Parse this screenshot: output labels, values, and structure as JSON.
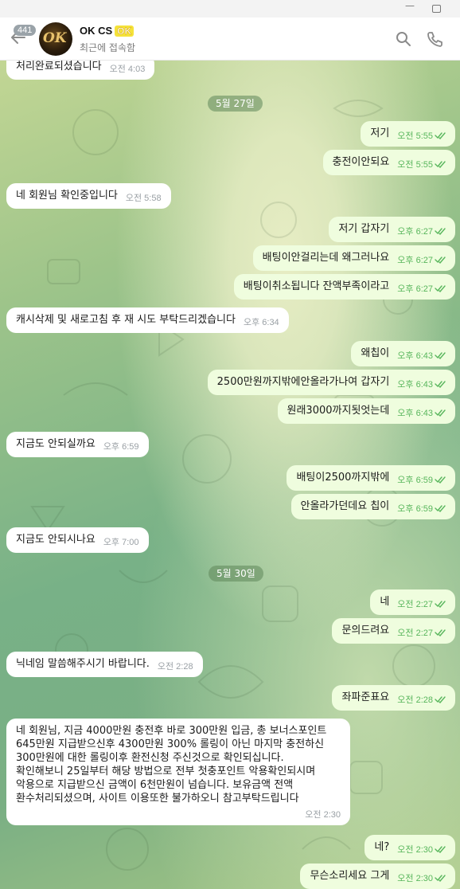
{
  "header": {
    "unread_count": "441",
    "avatar_text": "OK",
    "title": "OK CS",
    "title_badge": "OK",
    "status": "최근에 접속함"
  },
  "chat": {
    "dates": [
      "5월 27일",
      "5월 30일"
    ],
    "messages": [
      {
        "dir": "in",
        "text": "처리완료되셨습니다",
        "time": "오전 4:03"
      },
      {
        "dir": "out",
        "text": "저기",
        "time": "오전 5:55"
      },
      {
        "dir": "out",
        "text": "충전이안되요",
        "time": "오전 5:55"
      },
      {
        "dir": "in",
        "text": "네 회원님 확인중입니다",
        "time": "오전 5:58"
      },
      {
        "dir": "out",
        "text": "저기 갑자기",
        "time": "오후 6:27"
      },
      {
        "dir": "out",
        "text": "배팅이안걸리는데 왜그러나요",
        "time": "오후 6:27"
      },
      {
        "dir": "out",
        "text": "배팅이취소됩니다 잔액부족이라고",
        "time": "오후 6:27"
      },
      {
        "dir": "in",
        "text": "캐시삭제 및 새로고침 후 재 시도 부탁드리겠습니다",
        "time": "오후 6:34"
      },
      {
        "dir": "out",
        "text": "왜칩이",
        "time": "오후 6:43"
      },
      {
        "dir": "out",
        "text": "2500만원까지밖에안올라가나여 갑자기",
        "time": "오후 6:43"
      },
      {
        "dir": "out",
        "text": "원래3000까지됫엇는데",
        "time": "오후 6:43"
      },
      {
        "dir": "in",
        "text": "지금도 안되실까요",
        "time": "오후 6:59"
      },
      {
        "dir": "out",
        "text": "배팅이2500까지밖에",
        "time": "오후 6:59"
      },
      {
        "dir": "out",
        "text": "안올라가던데요 칩이",
        "time": "오후 6:59"
      },
      {
        "dir": "in",
        "text": "지금도 안되시나요",
        "time": "오후 7:00"
      },
      {
        "dir": "out",
        "text": "네",
        "time": "오전 2:27"
      },
      {
        "dir": "out",
        "text": "문의드려요",
        "time": "오전 2:27"
      },
      {
        "dir": "in",
        "text": "닉네임 말씀해주시기 바랍니다.",
        "time": "오전 2:28"
      },
      {
        "dir": "out",
        "text": "좌파준표요",
        "time": "오전 2:28"
      },
      {
        "dir": "in",
        "lines": [
          "네 회원님, 지금 4000만원 충전후 바로 300만원 입금, 총 보너스포인트",
          "645만원 지급받으신후 4300만원 300% 롤링이 아닌 마지막 충전하신",
          "300만원에 대한 롤링이후 환전신청 주신것으로 확인되십니다.",
          "확인해보니 25일부터 해당 방법으로 전부 첫충포인트 악용확인되시며",
          "악용으로 지급받으신 금액이 6천만원이 넘습니다. 보유금액 전액",
          "환수처리되셨으며, 사이트 이용또한 불가하오니 참고부탁드립니다"
        ],
        "time": "오전 2:30"
      },
      {
        "dir": "out",
        "text": "네?",
        "time": "오전 2:30"
      },
      {
        "dir": "out",
        "text": "무슨소리세요 그게",
        "time": "오전 2:30"
      }
    ]
  }
}
